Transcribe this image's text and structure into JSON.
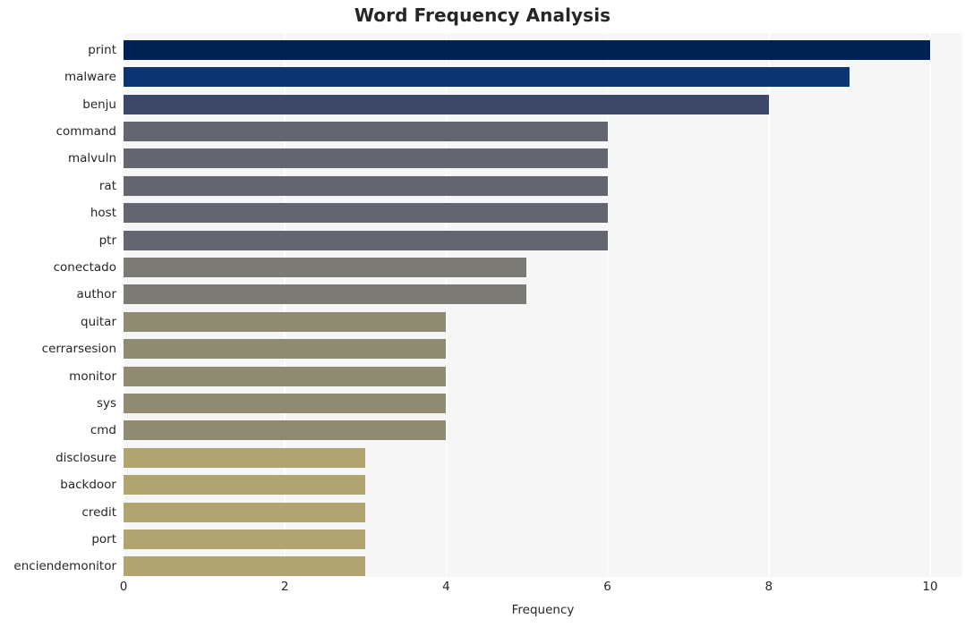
{
  "chart_data": {
    "type": "bar",
    "orientation": "horizontal",
    "title": "Word Frequency Analysis",
    "xlabel": "Frequency",
    "ylabel": "",
    "xlim": [
      0,
      10.4
    ],
    "xticks": [
      0,
      2,
      4,
      6,
      8,
      10
    ],
    "xtick_labels": [
      "0",
      "2",
      "4",
      "6",
      "8",
      "10"
    ],
    "grid": "vertical-white",
    "legend": "none",
    "categories": [
      "print",
      "malware",
      "benju",
      "command",
      "malvuln",
      "rat",
      "host",
      "ptr",
      "conectado",
      "author",
      "quitar",
      "cerrarsesion",
      "monitor",
      "sys",
      "cmd",
      "disclosure",
      "backdoor",
      "credit",
      "port",
      "enciendemonitor"
    ],
    "values": [
      10,
      9,
      8,
      6,
      6,
      6,
      6,
      6,
      5,
      5,
      4,
      4,
      4,
      4,
      4,
      3,
      3,
      3,
      3,
      3
    ],
    "bar_colors": [
      "#002253",
      "#0b3570",
      "#3d4868",
      "#63656f",
      "#63656f",
      "#63656f",
      "#63656f",
      "#63656f",
      "#7b7a74",
      "#7b7a74",
      "#8f8b72",
      "#8f8b72",
      "#8f8b72",
      "#8f8b72",
      "#8f8b72",
      "#b0a470",
      "#b0a470",
      "#b0a470",
      "#b0a470",
      "#b0a470"
    ],
    "plot_background": "#f6f6f6",
    "figure_background": "#ffffff",
    "text_color": "#262626"
  }
}
